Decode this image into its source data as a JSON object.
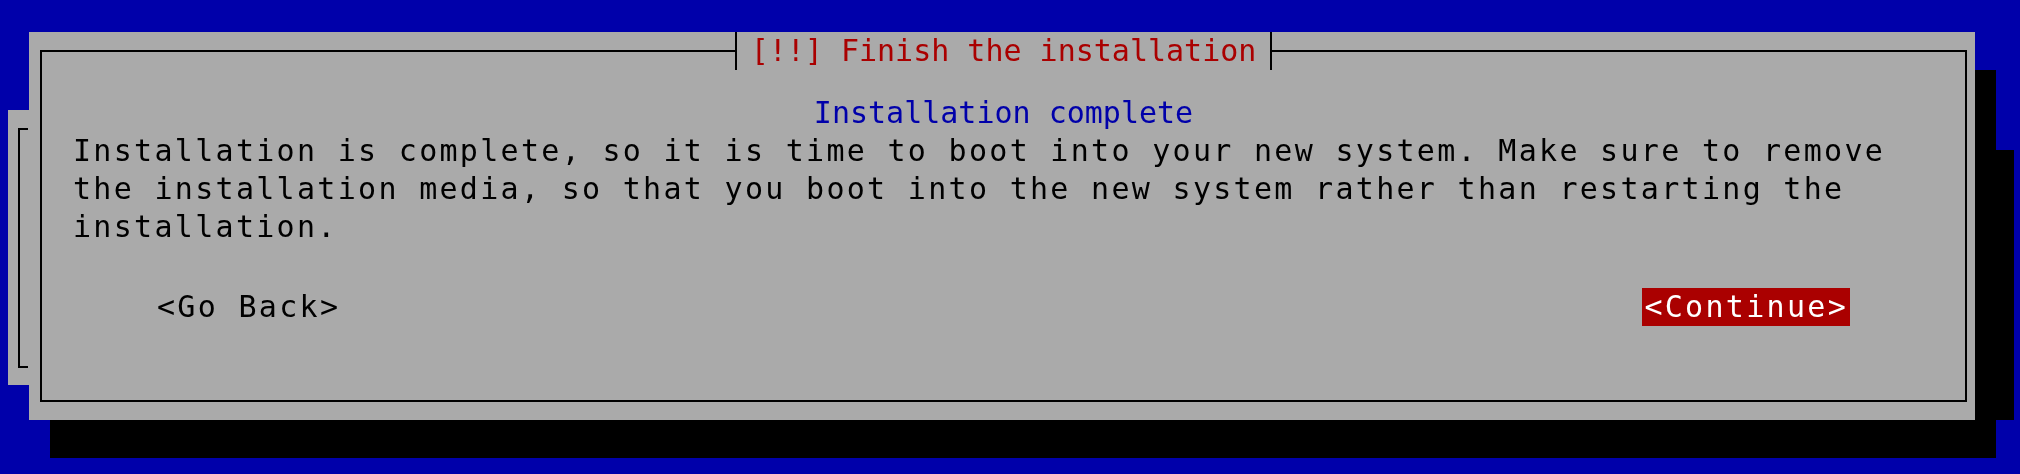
{
  "dialog": {
    "title": "[!!] Finish the installation",
    "heading": "Installation complete",
    "message": "Installation is complete, so it is time to boot into your new system. Make sure to remove the installation media, so that you boot into the new system rather than restarting the installation.",
    "buttons": [
      {
        "label": "<Go Back>",
        "selected": false
      },
      {
        "label": "<Continue>",
        "selected": true
      }
    ]
  }
}
